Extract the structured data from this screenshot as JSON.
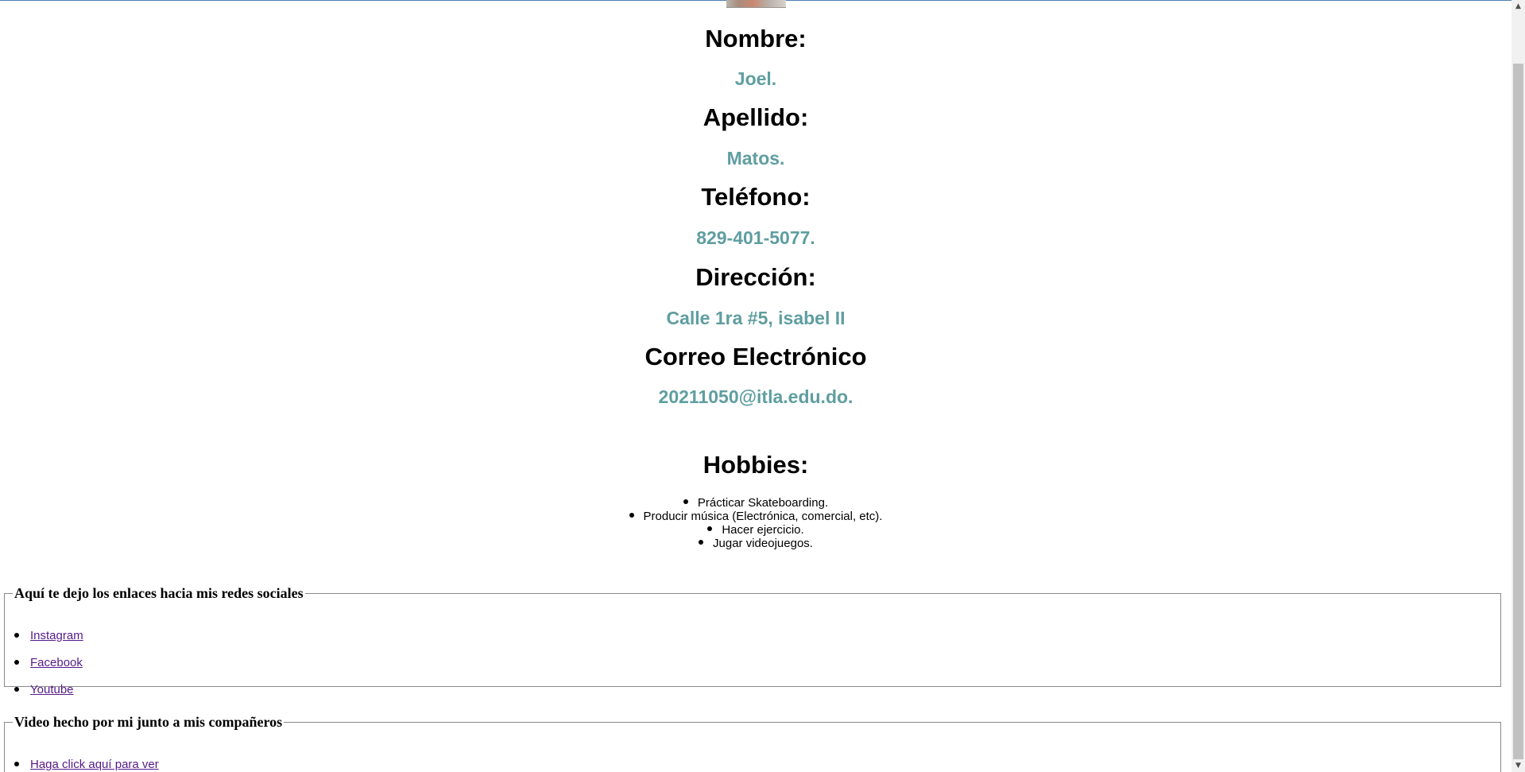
{
  "profile": {
    "fields": [
      {
        "label": "Nombre:",
        "value": "Joel."
      },
      {
        "label": "Apellido:",
        "value": "Matos."
      },
      {
        "label": "Teléfono:",
        "value": "829-401-5077."
      },
      {
        "label": "Dirección:",
        "value": "Calle 1ra #5, isabel II"
      },
      {
        "label": "Correo Electrónico",
        "value": "20211050@itla.edu.do."
      }
    ]
  },
  "hobbies": {
    "title": "Hobbies:",
    "items": [
      "Prácticar Skateboarding.",
      "Producir música (Electrónica, comercial, etc).",
      "Hacer ejercicio.",
      "Jugar videojuegos."
    ]
  },
  "social": {
    "legend": "Aquí te dejo los enlaces hacia mis redes sociales",
    "links": [
      "Instagram",
      "Facebook",
      "Youtube"
    ]
  },
  "video": {
    "legend": "Video hecho por mi junto a mis compañeros",
    "link": "Haga click aquí para ver"
  },
  "colors": {
    "value_text": "#5f9ea0",
    "visited_link": "#551a8b"
  },
  "icons": {
    "scroll_up": "scroll-up-arrow-icon",
    "scroll_down": "scroll-down-arrow-icon"
  }
}
